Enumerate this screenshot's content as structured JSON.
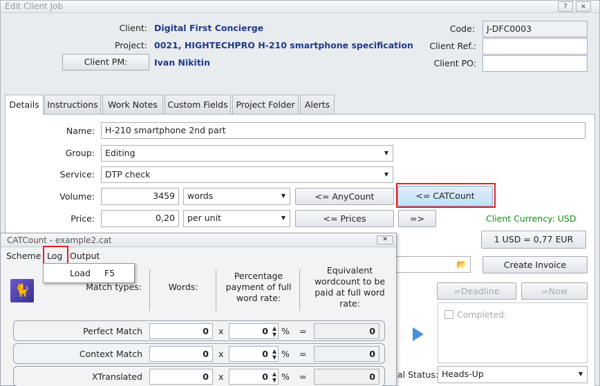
{
  "window": {
    "title": "Edit Client Job",
    "min_icon": "?",
    "close_icon": "×"
  },
  "header": {
    "client_label": "Client:",
    "client_value": "Digital First Concierge",
    "project_label": "Project:",
    "project_value": "0021, HIGHTECHPRO H-210 smartphone specification",
    "client_pm_button": "Client PM:",
    "client_pm_value": "Ivan Nikitin",
    "code_label": "Code:",
    "code_value": "J-DFC0003",
    "client_ref_label": "Client Ref.:",
    "client_ref_value": "",
    "client_po_label": "Client PO:",
    "client_po_value": ""
  },
  "tabs": [
    "Details",
    "Instructions",
    "Work Notes",
    "Custom Fields",
    "Project Folder",
    "Alerts"
  ],
  "details": {
    "name_label": "Name:",
    "name_value": "H-210 smartphone 2nd part",
    "group_label": "Group:",
    "group_value": "Editing",
    "service_label": "Service:",
    "service_value": "DTP check",
    "volume_label": "Volume:",
    "volume_value": "3459",
    "volume_unit": "words",
    "anycount_button": "<= AnyCount",
    "catcount_button": "<= CATCount",
    "price_label": "Price:",
    "price_value": "0,20",
    "price_unit": "per unit",
    "prices_button": "<= Prices",
    "arrow_button": "=>",
    "currency_label": "Client Currency: USD",
    "rate_button": "1 USD = 0,77 EUR",
    "create_invoice_button": "Create Invoice",
    "deadline_button": "=Deadline",
    "now_button": "=Now",
    "completed_label": "Completed:",
    "status_label": "al Status:",
    "status_value": "Heads-Up"
  },
  "catcount": {
    "title": "CATCount - example2.cat",
    "menu": [
      "Scheme",
      "Log",
      "Output"
    ],
    "log_menu": {
      "item": "Load",
      "shortcut": "F5"
    },
    "col_match_types": "Match types:",
    "col_words": "Words:",
    "col_percentage": "Percentage payment of full word rate:",
    "col_equivalent": "Equivalent wordcount to be paid at full word rate:",
    "rows": [
      {
        "label": "Perfect Match",
        "words": "0",
        "x": "x",
        "percent": "0",
        "pct_sign": "%",
        "eq": "=",
        "result": "0"
      },
      {
        "label": "Context Match",
        "words": "0",
        "x": "x",
        "percent": "0",
        "pct_sign": "%",
        "eq": "=",
        "result": "0"
      },
      {
        "label": "XTranslated",
        "words": "0",
        "x": "x",
        "percent": "0",
        "pct_sign": "%",
        "eq": "=",
        "result": "0"
      }
    ]
  },
  "colors": {
    "value_blue": "#1f3a8a",
    "highlight_red": "#e02020",
    "currency_green": "#1a8a1a"
  }
}
